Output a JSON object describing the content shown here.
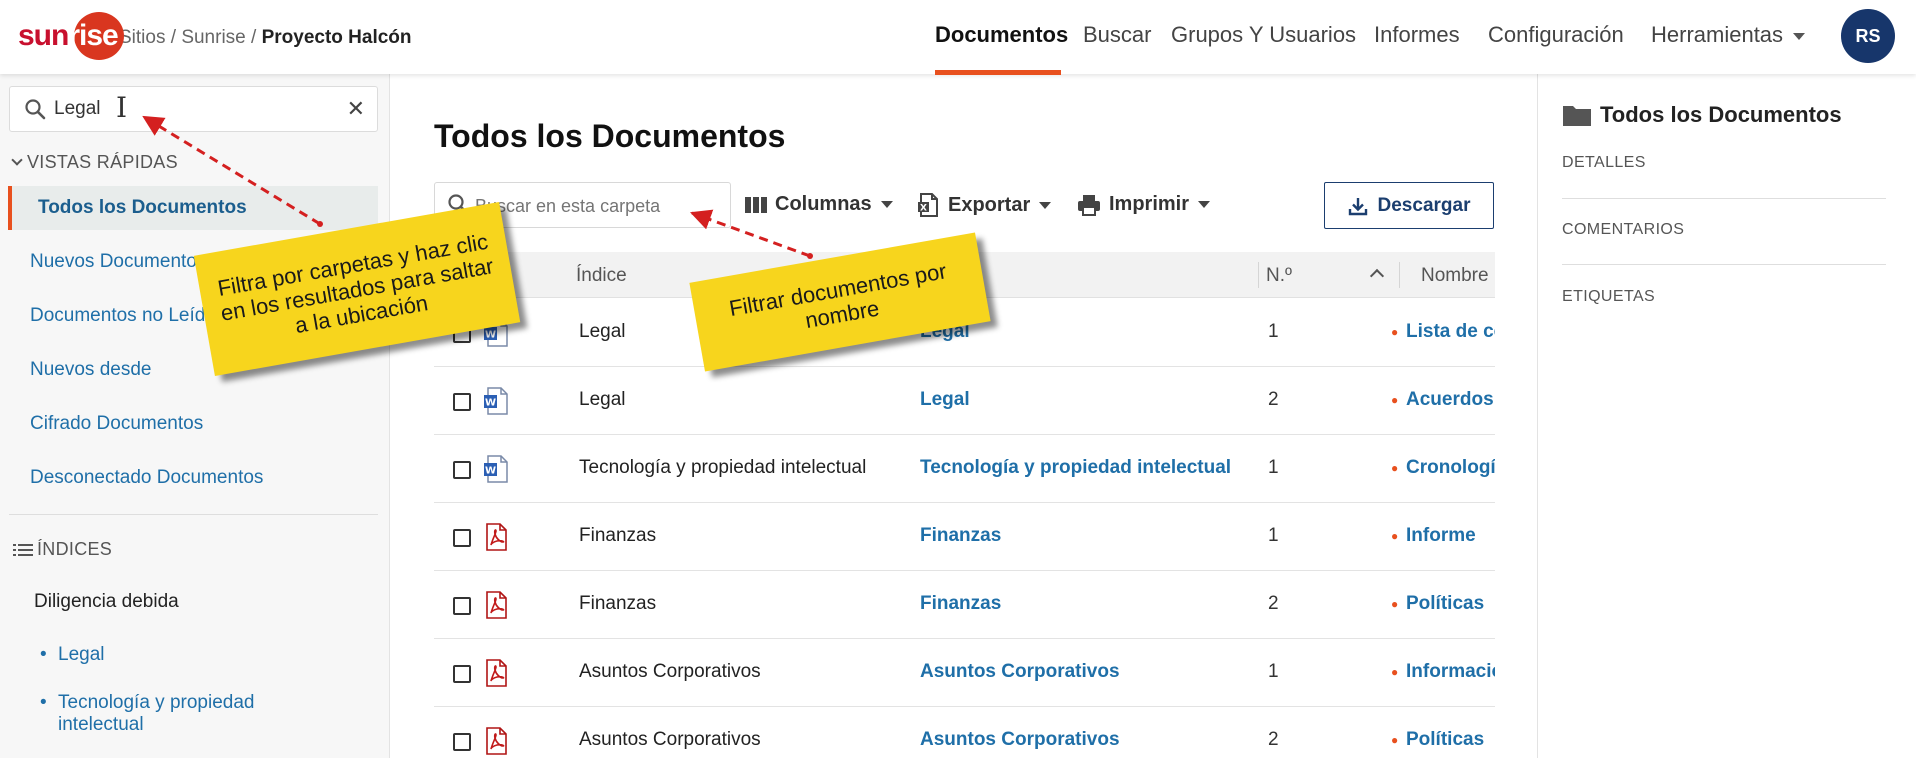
{
  "header": {
    "logo_text": "sunrise",
    "logo_text_left": "sun",
    "logo_text_right": "rise",
    "breadcrumb": [
      "Sitios",
      "Sunrise",
      "Proyecto Halcón"
    ],
    "breadcrumb_separator": "/",
    "nav": [
      {
        "label": "Documentos",
        "active": true
      },
      {
        "label": "Buscar"
      },
      {
        "label": "Grupos Y Usuarios"
      },
      {
        "label": "Informes"
      },
      {
        "label": "Configuración"
      },
      {
        "label": "Herramientas"
      }
    ],
    "avatar_initials": "RS"
  },
  "sidebar": {
    "search_value": "Legal",
    "quick_views_title": "VISTAS RÁPIDAS",
    "quick_views": [
      {
        "label": "Todos los Documentos",
        "active": true
      },
      {
        "label": "Nuevos Documentos"
      },
      {
        "label": "Documentos no Leídos"
      },
      {
        "label": "Nuevos desde"
      },
      {
        "label": "Cifrado Documentos"
      },
      {
        "label": "Desconectado Documentos"
      }
    ],
    "indexes_title": "ÍNDICES",
    "indexes_group": "Diligencia debida",
    "indexes_items": [
      "Legal",
      "Tecnología y propiedad intelectual"
    ]
  },
  "main": {
    "title": "Todos los Documentos",
    "search_placeholder": "Buscar en esta carpeta",
    "tools": {
      "columns": "Columnas",
      "export": "Exportar",
      "print": "Imprimir"
    },
    "download_label": "Descargar",
    "columns": {
      "index": "Índice",
      "number": "N.º",
      "name": "Nombre"
    },
    "rows": [
      {
        "type": "word",
        "index": "Legal",
        "group": "Legal",
        "number": "1",
        "name": "Lista de control"
      },
      {
        "type": "word",
        "index": "Legal",
        "group": "Legal",
        "number": "2",
        "name": "Acuerdos"
      },
      {
        "type": "word",
        "index": "Tecnología y propiedad intelectual",
        "group": "Tecnología y propiedad intelectual",
        "number": "1",
        "name": "Cronología"
      },
      {
        "type": "pdf",
        "index": "Finanzas",
        "group": "Finanzas",
        "number": "1",
        "name": "Informe"
      },
      {
        "type": "pdf",
        "index": "Finanzas",
        "group": "Finanzas",
        "number": "2",
        "name": "Políticas"
      },
      {
        "type": "pdf",
        "index": "Asuntos Corporativos",
        "group": "Asuntos Corporativos",
        "number": "1",
        "name": "Información"
      },
      {
        "type": "pdf",
        "index": "Asuntos Corporativos",
        "group": "Asuntos Corporativos",
        "number": "2",
        "name": "Políticas"
      }
    ]
  },
  "right_panel": {
    "title": "Todos los Documentos",
    "sections": [
      "DETALLES",
      "COMENTARIOS",
      "ETIQUETAS"
    ]
  },
  "callouts": {
    "left": "Filtra por carpetas y haz clic en los resultados para saltar a la ubicación",
    "right": "Filtrar documentos por nombre"
  },
  "colors": {
    "accent": "#e8501e",
    "link": "#1f6fa8",
    "brand_navy": "#17366b",
    "note_yellow": "#f7d51d",
    "arrow_red": "#d42020"
  }
}
